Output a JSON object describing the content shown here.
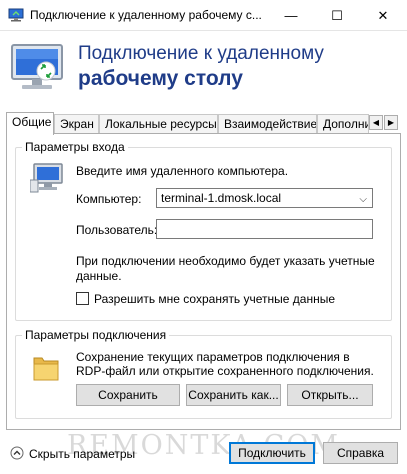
{
  "window": {
    "title": "Подключение к удаленному рабочему с...",
    "minimize_glyph": "—",
    "maximize_glyph": "☐",
    "close_glyph": "✕"
  },
  "banner": {
    "line1": "Подключение к удаленному",
    "line2": "рабочему столу"
  },
  "tabs": [
    {
      "label": "Общие",
      "active": true
    },
    {
      "label": "Экран"
    },
    {
      "label": "Локальные ресурсы"
    },
    {
      "label": "Взаимодействие"
    },
    {
      "label": "Дополнит"
    }
  ],
  "tab_scroll": {
    "left": "◀",
    "right": "▶"
  },
  "login_group": {
    "title": "Параметры входа",
    "hint": "Введите имя удаленного компьютера.",
    "computer_label": "Компьютер:",
    "computer_value": "terminal-1.dmosk.local",
    "user_label": "Пользователь:",
    "user_value": "",
    "note_line1": "При подключении необходимо будет указать учетные",
    "note_line2": "данные.",
    "save_creds_label": "Разрешить мне сохранять учетные данные",
    "save_creds_checked": false
  },
  "connection_group": {
    "title": "Параметры подключения",
    "desc_line1": "Сохранение текущих параметров подключения в",
    "desc_line2": "RDP-файл или открытие сохраненного подключения.",
    "save_button": "Сохранить",
    "save_as_button": "Сохранить как...",
    "open_button": "Открыть..."
  },
  "footer": {
    "hide_params": "Скрыть параметры",
    "connect_button": "Подключить",
    "help_button": "Справка",
    "watermark": "REMONTKA.COM"
  },
  "colors": {
    "banner_text": "#1f3c88",
    "accent": "#0078d7"
  }
}
